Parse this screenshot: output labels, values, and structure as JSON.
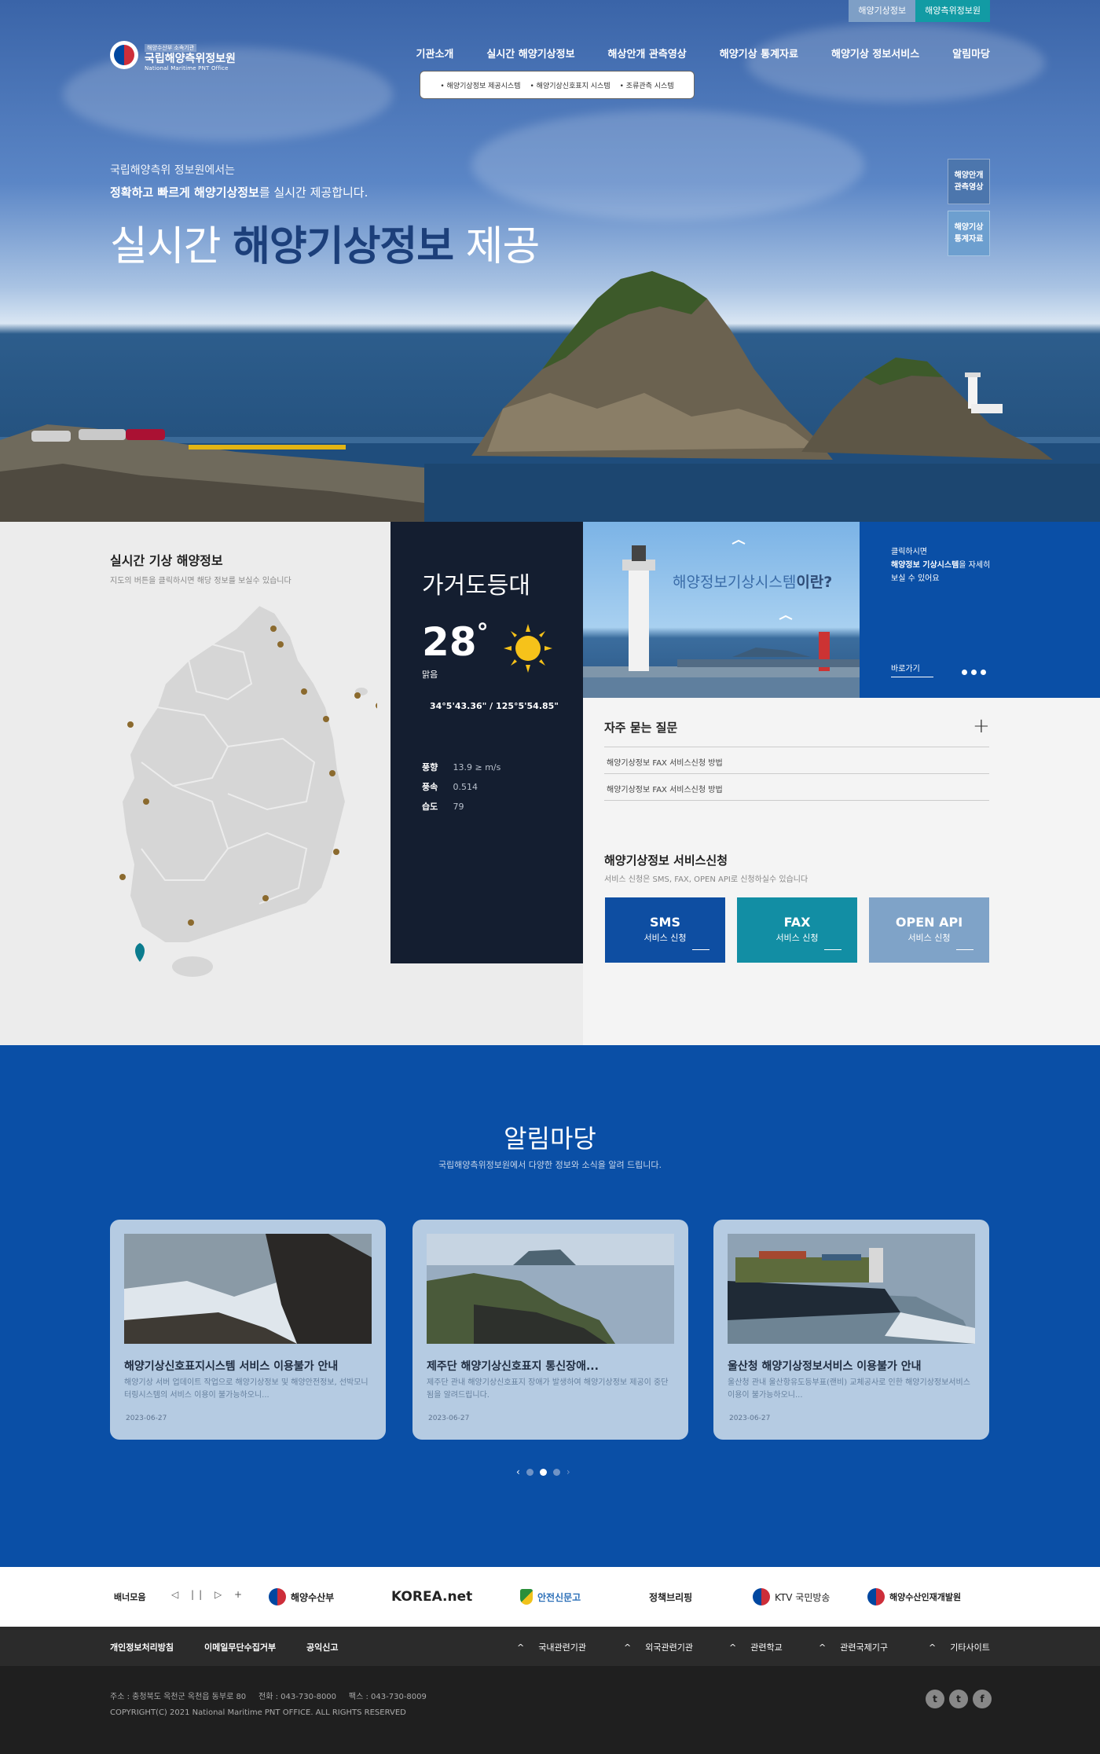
{
  "topbar": {
    "btn1": "해양기상정보",
    "btn2": "해양측위정보원"
  },
  "logo": {
    "badge": "해양수산부 소속기관",
    "name": "국립해양측위정보원",
    "en": "National Maritime PNT Office"
  },
  "gnb": [
    "기관소개",
    "실시간 해양기상정보",
    "해상안개 관측영상",
    "해양기상 통계자료",
    "해양기상 정보서비스",
    "알림마당"
  ],
  "submenu": [
    "해양기상정보 제공시스템",
    "해양기상신호표지 시스템",
    "조류관측 시스템"
  ],
  "hero": {
    "line1": "국립해양측위 정보원에서는",
    "line2_bold": "정확하고 빠르게 해양기상정보",
    "line2_rest": "를 실시간 제공합니다.",
    "big_pre": "실시간 ",
    "big_hl": "해양기상정보",
    "big_post": " 제공"
  },
  "quick": [
    {
      "line1": "해양안개",
      "line2": "관측영상"
    },
    {
      "line1": "해양기상",
      "line2": "통계자료"
    }
  ],
  "weather": {
    "title": "실시간 기상 해양정보",
    "desc": "지도의 버튼을 클릭하시면 해당 정보를 보실수 있습니다"
  },
  "station": {
    "name": "가거도등대",
    "temp": "28",
    "deg": "°",
    "cond": "맑음",
    "coord": "34°5'43.36\" / 125°5'54.85\"",
    "rows": [
      {
        "k": "풍향",
        "v": "13.9 ≥ m/s"
      },
      {
        "k": "풍속",
        "v": "0.514"
      },
      {
        "k": "습도",
        "v": "79"
      }
    ]
  },
  "promo": {
    "title_a": "해양정보기상시스템",
    "title_b": "이란?",
    "side_l1": "클릭하시면",
    "side_l2b": "해양정보 기상시스템",
    "side_l2": "을 자세히",
    "side_l3": "보실 수 있어요",
    "go": "바로가기"
  },
  "faq": {
    "title": "자주 묻는 질문",
    "items": [
      "해양기상정보 FAX 서비스신청 방법",
      "해양기상정보 FAX 서비스신청 방법"
    ]
  },
  "service": {
    "title": "해양기상정보 서비스신청",
    "desc": "서비스 신청은 SMS, FAX, OPEN API로 신청하실수 있습니다",
    "items": [
      {
        "h": "SMS",
        "s": "서비스 신청"
      },
      {
        "h": "FAX",
        "s": "서비스 신청"
      },
      {
        "h": "OPEN API",
        "s": "서비스 신청"
      }
    ]
  },
  "notice": {
    "title": "알림마당",
    "desc": "국립해양측위정보원에서 다양한 정보와 소식을 알려 드립니다.",
    "cards": [
      {
        "title": "해양기상신호표지시스템 서비스 이용불가 안내",
        "desc": "해양기상 서버 업데이트 작업으로 해양기상정보 및 해양안전정보, 선박모니터링시스템의 서비스 이용이 불가능하오니...",
        "date": "2023-06-27"
      },
      {
        "title": "제주단 해양기상신호표지 통신장애...",
        "desc": "제주단 관내 해양기상신호표지 장애가 발생하여 해양기상정보 제공이 중단됨을 알려드립니다.",
        "date": "2023-06-27"
      },
      {
        "title": "울산청 해양기상정보서비스 이용불가 안내",
        "desc": "울산청 관내 울산항유도등부표(랜비) 교체공사로 인한 해양기상정보서비스 이용이 불가능하오니...",
        "date": "2023-06-27"
      }
    ]
  },
  "banners": {
    "label": "배너모음",
    "controls": "◁ || ▷ +",
    "items": [
      "해양수산부",
      "KOREA.net",
      "안전신문고",
      "정책브리핑",
      "KTV 국민방송",
      "해양수산인재개발원"
    ]
  },
  "footer": {
    "links": [
      "개인정보처리방침",
      "이메일무단수집거부",
      "공익신고"
    ],
    "dropdowns": [
      "국내관련기관",
      "외국관련기관",
      "관련학교",
      "관련국제기구",
      "기타사이트"
    ],
    "addr": "주소 : 충청북도 옥천군 옥천읍 동부로 80     전화 : 043-730-8000     팩스 : 043-730-8009",
    "copy": "COPYRIGHT(C) 2021 National Maritime PNT OFFICE. ALL RIGHTS RESERVED",
    "sns": [
      "t",
      "t",
      "f"
    ]
  },
  "colors": {
    "brand": "#0a4fa6",
    "navy": "#141e30",
    "teal": "#128ea4",
    "light": "#7fa3c8"
  }
}
